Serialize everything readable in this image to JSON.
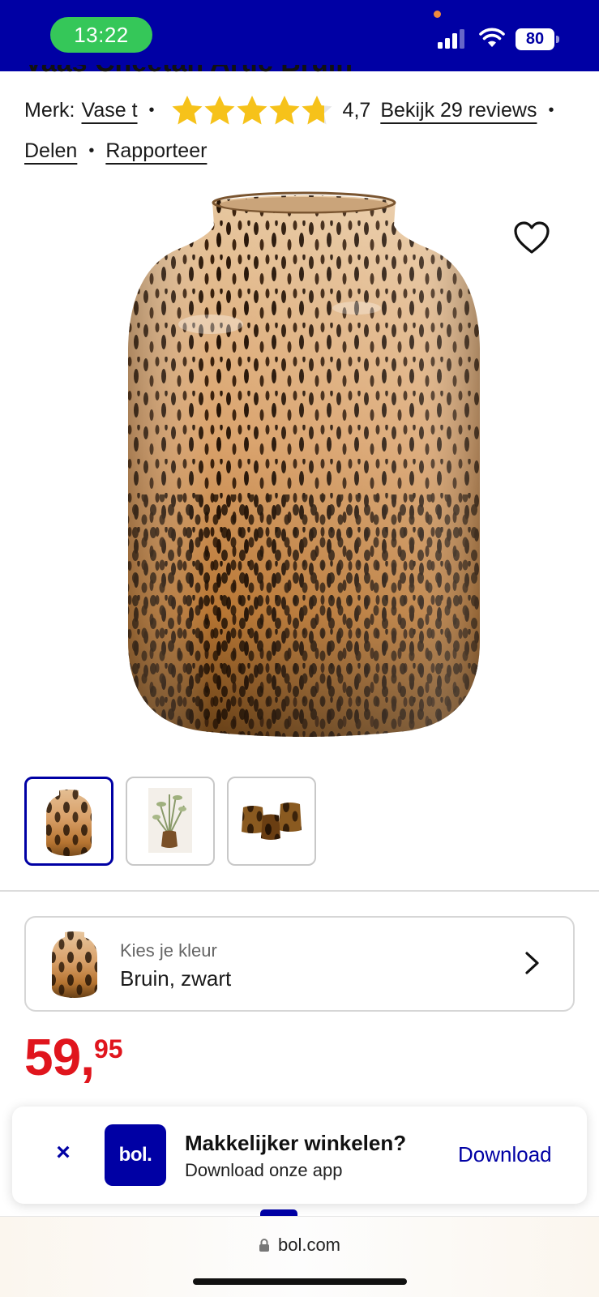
{
  "status_bar": {
    "time": "13:22",
    "battery": "80",
    "colors": {
      "background": "#0000a4",
      "clock_pill": "#35c759"
    }
  },
  "product": {
    "title_fragment": "Vaas Cheetah Artic Bruin",
    "brand_label": "Merk:",
    "brand_name": "Vase t",
    "rating": "4,7",
    "rating_stars_value": 4.7,
    "reviews_link": "Bekijk 29 reviews",
    "share_link": "Delen",
    "report_link": "Rapporteer",
    "image_icon": "vase-cheetah-image"
  },
  "thumbnails": [
    {
      "name": "vase-front",
      "active": true
    },
    {
      "name": "vase-with-branches",
      "active": false
    },
    {
      "name": "vase-group-of-three",
      "active": false
    }
  ],
  "variant": {
    "label": "Kies je kleur",
    "value": "Bruin, zwart"
  },
  "price": {
    "main": "59,",
    "cents": "95",
    "color": "#e0151d"
  },
  "app_banner": {
    "close_symbol": "×",
    "logo_text": "bol.",
    "title": "Makkelijker winkelen?",
    "subtitle": "Download onze app",
    "download_label": "Download"
  },
  "browser": {
    "url": "bol.com"
  },
  "colors": {
    "brand_blue": "#0000a4",
    "star_yellow": "#f6c21a",
    "price_red": "#e0151d"
  }
}
